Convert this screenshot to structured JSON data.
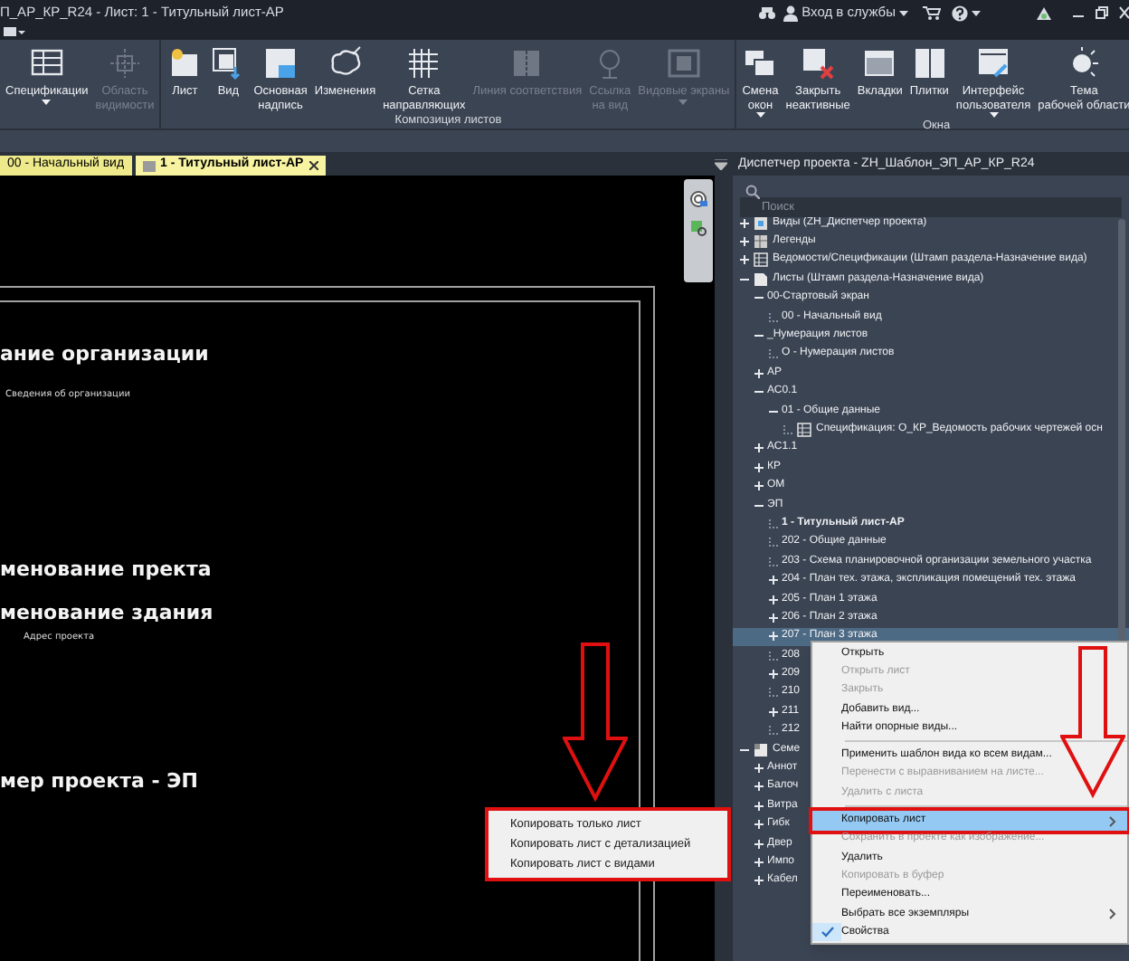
{
  "window": {
    "title": "П_АР_КР_R24 - Лист: 1 - Титульный лист-АР",
    "sign_in": "Вход в службы"
  },
  "ribbon": {
    "panels": [
      {
        "buttons": [
          {
            "kind": "schedule",
            "label": "Спецификации",
            "disabled": false,
            "dropdown": true
          },
          {
            "kind": "scopebox",
            "label": "Область\nвидимости",
            "disabled": true,
            "dropdown": false
          }
        ]
      },
      {
        "title": "Композиция листов",
        "buttons": [
          {
            "kind": "sheet",
            "label": "Лист",
            "disabled": false,
            "dropdown": false
          },
          {
            "kind": "view",
            "label": "Вид",
            "disabled": false,
            "dropdown": false
          },
          {
            "kind": "titleblock",
            "label": "Основная\nнадпись",
            "disabled": false,
            "dropdown": false
          },
          {
            "kind": "revision",
            "label": "Изменения",
            "disabled": false,
            "dropdown": false
          },
          {
            "kind": "grid",
            "label": "Сетка\nнаправляющих",
            "disabled": false,
            "dropdown": false
          },
          {
            "kind": "matchline",
            "label": "Линия соответствия",
            "disabled": true,
            "dropdown": false
          },
          {
            "kind": "viewref",
            "label": "Ссылка\nна вид",
            "disabled": true,
            "dropdown": false
          },
          {
            "kind": "viewports",
            "label": "Видовые экраны",
            "disabled": true,
            "dropdown": true
          }
        ]
      },
      {
        "title": "Окна",
        "buttons": [
          {
            "kind": "switch",
            "label": "Смена\nокон",
            "disabled": false,
            "dropdown": true
          },
          {
            "kind": "closeinactive",
            "label": "Закрыть\nнеактивные",
            "disabled": false,
            "dropdown": false
          },
          {
            "kind": "tabs",
            "label": "Вкладки",
            "disabled": false,
            "dropdown": false
          },
          {
            "kind": "tile",
            "label": "Плитки",
            "disabled": false,
            "dropdown": false
          },
          {
            "kind": "ui",
            "label": "Интерфейс\nпользователя",
            "disabled": false,
            "dropdown": true
          },
          {
            "kind": "theme",
            "label": "Тема\nрабочей области",
            "disabled": false,
            "dropdown": false
          }
        ]
      }
    ]
  },
  "tabs": [
    {
      "label": "00 - Начальный вид",
      "selected": false
    },
    {
      "label": "1 - Титульный лист-АР",
      "selected": true
    }
  ],
  "sheet": {
    "texts": [
      {
        "kind": "heading",
        "label": "ание организации"
      },
      {
        "kind": "note",
        "label": "Сведения об организации"
      },
      {
        "kind": "heading",
        "label": "менование пректа"
      },
      {
        "kind": "heading",
        "label": "менование здания"
      },
      {
        "kind": "note",
        "label": "Адрес проекта"
      },
      {
        "kind": "heading",
        "label": "мер проекта - ЭП"
      }
    ]
  },
  "browser": {
    "title": "Диспетчер проекта - ZH_Шаблон_ЭП_АР_КР_R24",
    "search": {
      "placeholder": "Поиск"
    },
    "tree": [
      {
        "label": "Виды (ZH_Диспетчер проекта)",
        "kind": "views",
        "expanded": false
      },
      {
        "label": "Легенды",
        "kind": "legends",
        "expanded": false
      },
      {
        "label": "Ведомости/Спецификации (Штамп раздела-Назначение вида)",
        "kind": "schedules",
        "expanded": false
      },
      {
        "label": "Листы (Штамп раздела-Назначение вида)",
        "kind": "sheets",
        "expanded": true,
        "children": [
          {
            "label": "00-Стартовый экран",
            "expanded": true,
            "children": [
              {
                "label": "00 - Начальный вид"
              }
            ]
          },
          {
            "label": "_Нумерация листов",
            "expanded": true,
            "children": [
              {
                "label": "О - Нумерация листов"
              }
            ]
          },
          {
            "label": "АР",
            "expanded": false
          },
          {
            "label": "АС0.1",
            "expanded": true,
            "children": [
              {
                "label": "01 - Общие данные",
                "expanded": true,
                "children": [
                  {
                    "label": "Спецификация: О_КР_Ведомость рабочих чертежей осн",
                    "kind": "schedule"
                  }
                ]
              }
            ]
          },
          {
            "label": "АС1.1",
            "expanded": false
          },
          {
            "label": "КР",
            "expanded": false
          },
          {
            "label": "ОМ",
            "expanded": false
          },
          {
            "label": "ЭП",
            "expanded": true,
            "children": [
              {
                "label": "1 - Титульный лист-АР",
                "active": true,
                "selected": false
              },
              {
                "label": "202 - Общие данные",
                "selected": false
              },
              {
                "label": "203 - Схема планировочной организации земельного участка",
                "selected": false
              },
              {
                "label": "204 - План тех. этажа, экспликация помещений тех. этажа",
                "expanded": false,
                "selected": false
              },
              {
                "label": "205 - План 1 этажа",
                "expanded": false,
                "selected": false
              },
              {
                "label": "206 - План 2 этажа",
                "expanded": false,
                "selected": false
              },
              {
                "label": "207 - План 3 этажа",
                "expanded": false,
                "selected": true
              },
              {
                "label": "208",
                "selected": false
              },
              {
                "label": "209",
                "expanded": false,
                "selected": false
              },
              {
                "label": "210",
                "selected": false
              },
              {
                "label": "211",
                "expanded": false,
                "selected": false
              },
              {
                "label": "212",
                "selected": false
              }
            ]
          }
        ]
      },
      {
        "label": "Семе",
        "kind": "families",
        "expanded": true,
        "children": [
          {
            "label": "Аннот",
            "expanded": false
          },
          {
            "label": "Балоч",
            "expanded": false
          },
          {
            "label": "Витра",
            "expanded": false
          },
          {
            "label": "Гибк",
            "expanded": false
          },
          {
            "label": "Двер",
            "expanded": false
          },
          {
            "label": "Импо",
            "expanded": false
          },
          {
            "label": "Кабел",
            "expanded": false
          }
        ]
      }
    ]
  },
  "context_menu": {
    "items": [
      {
        "kind": "item",
        "label": "Открыть",
        "disabled": false
      },
      {
        "kind": "item",
        "label": "Открыть лист",
        "disabled": true
      },
      {
        "kind": "item",
        "label": "Закрыть",
        "disabled": true
      },
      {
        "kind": "item",
        "label": "Добавить вид...",
        "disabled": false
      },
      {
        "kind": "item",
        "label": "Найти опорные виды...",
        "disabled": false
      },
      {
        "kind": "separator"
      },
      {
        "kind": "item",
        "label": "Применить шаблон вида ко всем видам...",
        "disabled": false
      },
      {
        "kind": "item",
        "label": "Перенести с выравниванием на листе...",
        "disabled": true
      },
      {
        "kind": "item",
        "label": "Удалить с листа",
        "disabled": true
      },
      {
        "kind": "separator"
      },
      {
        "kind": "item",
        "label": "Копировать лист",
        "disabled": false,
        "selected": true,
        "submenu": true
      },
      {
        "kind": "item",
        "label": "Сохранить в проекте как изображение...",
        "disabled": true
      },
      {
        "kind": "item",
        "label": "Удалить",
        "disabled": false
      },
      {
        "kind": "item",
        "label": "Копировать в буфер",
        "disabled": true
      },
      {
        "kind": "item",
        "label": "Переименовать...",
        "disabled": false
      },
      {
        "kind": "item",
        "label": "Выбрать все экземпляры",
        "disabled": false,
        "submenu": true
      },
      {
        "kind": "item",
        "label": "Свойства",
        "disabled": false,
        "checked": true
      }
    ]
  },
  "submenu": {
    "items": [
      {
        "label": "Копировать только лист"
      },
      {
        "label": "Копировать лист с детализацией"
      },
      {
        "label": "Копировать лист с видами"
      }
    ]
  }
}
